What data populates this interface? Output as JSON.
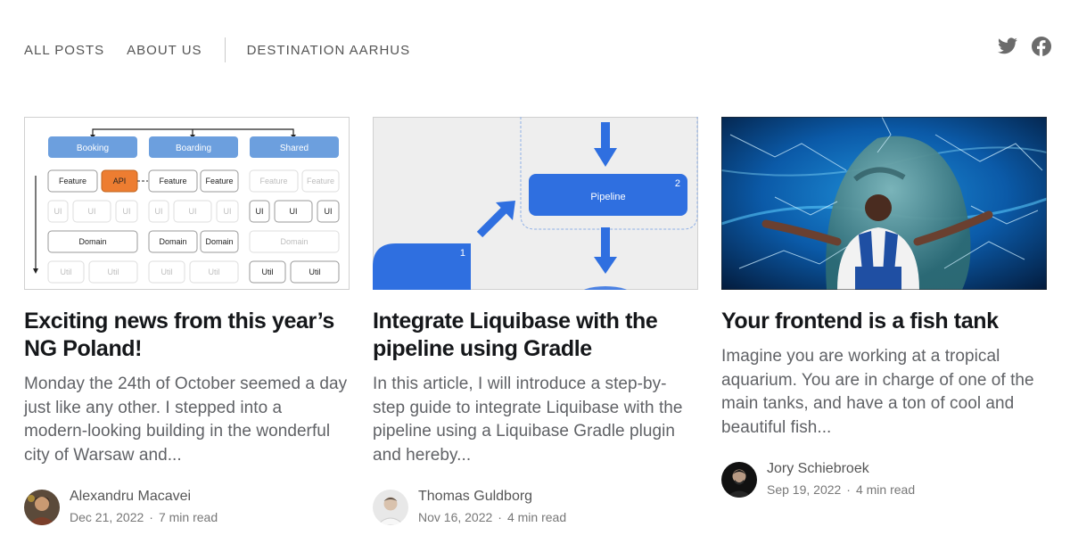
{
  "nav": {
    "links": [
      "ALL POSTS",
      "ABOUT US",
      "DESTINATION AARHUS"
    ],
    "social": [
      "twitter-icon",
      "facebook-icon"
    ]
  },
  "colors": {
    "accent_blue": "#2f6fe0",
    "diagram_box": "#6c9fde",
    "api_orange": "#ed7d31"
  },
  "cards": [
    {
      "title": "Exciting news from this year’s NG Poland!",
      "excerpt": "Monday the 24th of October seemed a day just like any other. I stepped into a modern-looking building in the wonderful city of Warsaw and...",
      "author": "Alexandru Macavei",
      "date": "Dec 21, 2022",
      "read_time": "7 min read",
      "image": {
        "headers": [
          "Booking",
          "Boarding",
          "Shared"
        ],
        "row_feature": [
          "Feature",
          "API",
          "Feature",
          "Feature",
          "Feature",
          "Feature"
        ],
        "row_ui": [
          "UI",
          "UI",
          "UI",
          "UI",
          "UI",
          "UI",
          "UI",
          "UI",
          "UI"
        ],
        "row_domain": [
          "Domain",
          "Domain",
          "Domain",
          "Domain"
        ],
        "row_util": [
          "Util",
          "Util",
          "Util",
          "Util",
          "Util",
          "Util"
        ]
      }
    },
    {
      "title": "Integrate Liquibase with the pipeline using Gradle",
      "excerpt": "In this article, I will introduce a step-by-step guide to integrate Liquibase with the pipeline using a Liquibase Gradle plugin and hereby...",
      "author": "Thomas Guldborg",
      "date": "Nov 16, 2022",
      "read_time": "4 min read",
      "image": {
        "box_label": "Pipeline",
        "box_number": "2",
        "left_number": "1"
      }
    },
    {
      "title": "Your frontend is a fish tank",
      "excerpt": "Imagine you are working at a tropical aquarium. You are in charge of one of the main tanks, and have a ton of cool and beautiful fish...",
      "author": "Jory Schiebroek",
      "date": "Sep 19, 2022",
      "read_time": "4 min read"
    }
  ]
}
